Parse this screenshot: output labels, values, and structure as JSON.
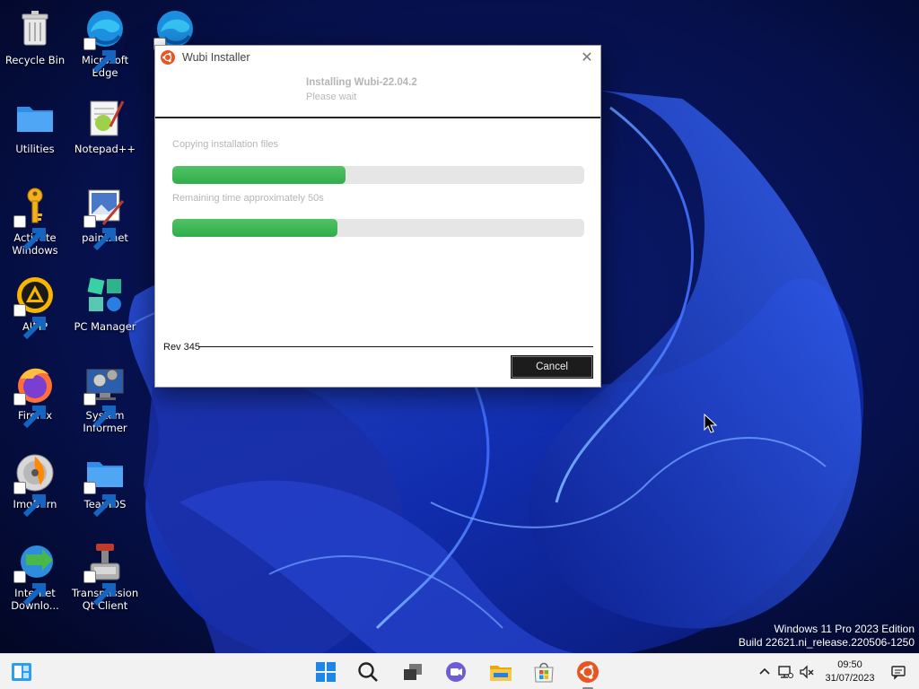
{
  "desktop": {
    "icons": [
      {
        "label": "Recycle Bin"
      },
      {
        "label": "Microsoft Edge"
      },
      {
        "label": ""
      },
      {
        "label": "Utilities"
      },
      {
        "label": "Notepad++"
      },
      {
        "label": "Activate Windows"
      },
      {
        "label": "paint.net"
      },
      {
        "label": "AIMP"
      },
      {
        "label": "PC Manager"
      },
      {
        "label": "Firefox"
      },
      {
        "label": "System Informer"
      },
      {
        "label": "ImgBurn"
      },
      {
        "label": "TeamOS"
      },
      {
        "label": "Internet Downlo..."
      },
      {
        "label": "Transmission Qt Client"
      }
    ]
  },
  "installer": {
    "window_title": "Wubi Installer",
    "header_title": "Installing Wubi-22.04.2",
    "header_subtitle": "Please wait",
    "progress1_label": "Copying installation files",
    "progress1_value": 0.42,
    "progress2_label": "Remaining time approximately 50s",
    "progress2_value": 0.4,
    "revision": "Rev 345",
    "cancel_label": "Cancel"
  },
  "watermark": {
    "line1": "Windows 11 Pro 2023 Edition",
    "line2": "Build 22621.ni_release.220506-1250"
  },
  "taskbar": {
    "icons": [
      "widgets-icon",
      "start-icon",
      "search-icon",
      "task-view-icon",
      "chat-icon",
      "file-explorer-icon",
      "store-icon",
      "ubuntu-icon"
    ],
    "time": "09:50",
    "date": "31/07/2023"
  },
  "colors": {
    "progress_fill": "#3cb554",
    "progress_track": "#e6e6e6",
    "ubuntu_orange": "#e95420",
    "taskbar_bg": "#f2f2f2"
  }
}
